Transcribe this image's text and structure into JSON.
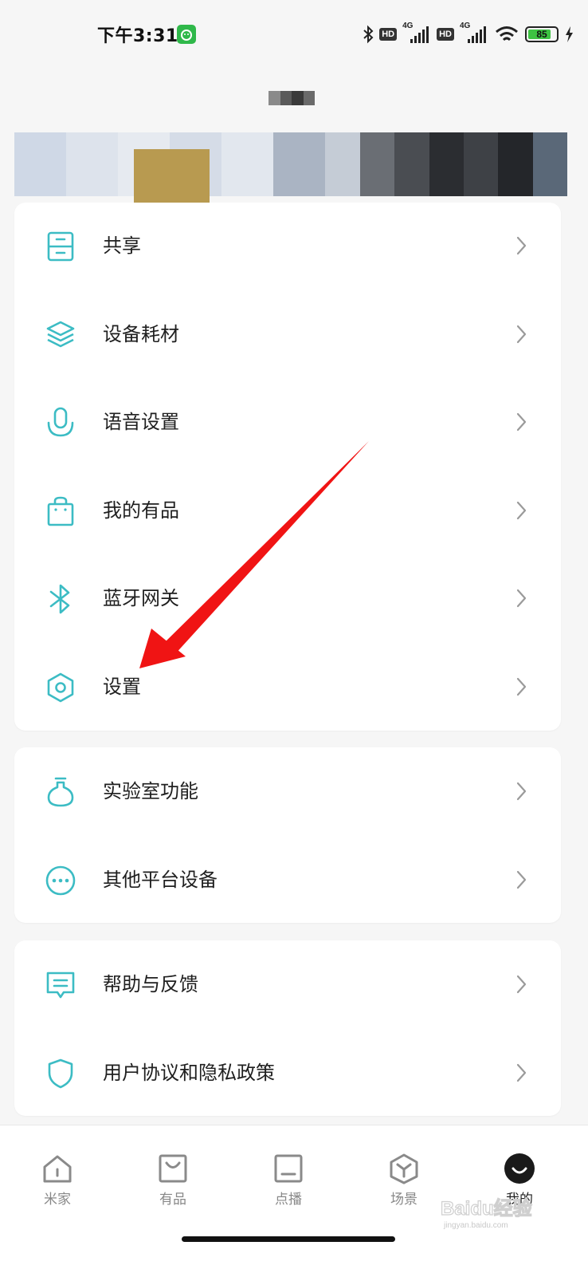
{
  "status_bar": {
    "time": "下午3:31",
    "app_icon": "notification-app-icon",
    "hd1": "HD",
    "hd2": "HD",
    "net1": "4G",
    "net2": "4G",
    "battery_level": "85",
    "battery_percent": 85
  },
  "profile": {
    "name_obscured": true
  },
  "cards": [
    {
      "items": [
        {
          "label": "共享",
          "icon": "shared-drawer-icon"
        },
        {
          "label": "设备耗材",
          "icon": "layers-icon"
        },
        {
          "label": "语音设置",
          "icon": "microphone-icon"
        },
        {
          "label": "我的有品",
          "icon": "shopping-bag-icon"
        },
        {
          "label": "蓝牙网关",
          "icon": "bluetooth-icon"
        },
        {
          "label": "设置",
          "icon": "settings-hexagon-icon"
        }
      ]
    },
    {
      "items": [
        {
          "label": "实验室功能",
          "icon": "flask-icon"
        },
        {
          "label": "其他平台设备",
          "icon": "more-dots-icon"
        }
      ]
    },
    {
      "items": [
        {
          "label": "帮助与反馈",
          "icon": "feedback-icon"
        },
        {
          "label": "用户协议和隐私政策",
          "icon": "shield-icon"
        }
      ]
    }
  ],
  "bottom_nav": [
    {
      "label": "米家",
      "icon": "home-icon"
    },
    {
      "label": "有品",
      "icon": "shop-bag-icon"
    },
    {
      "label": "点播",
      "icon": "tv-icon"
    },
    {
      "label": "场景",
      "icon": "scene-cube-icon"
    },
    {
      "label": "我的",
      "icon": "profile-avatar-icon",
      "active": true
    }
  ],
  "watermark": {
    "brand": "Baidu经验",
    "url": "jingyan.baidu.com"
  },
  "colors": {
    "accent": "#3cbcc4",
    "annotation_arrow": "#f01414",
    "background": "#f6f6f6"
  }
}
